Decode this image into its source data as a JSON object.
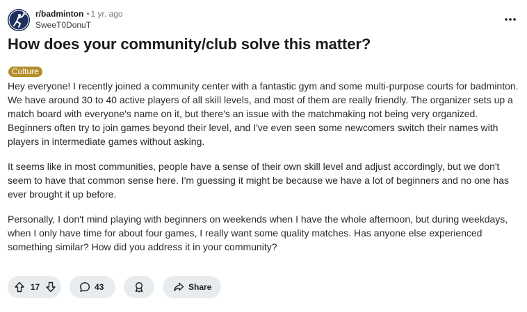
{
  "post": {
    "subreddit": "r/badminton",
    "separator": "•",
    "age": "1 yr. ago",
    "author": "SweeT0DonuT",
    "title": "How does your community/club solve this matter?",
    "flair": "Culture",
    "paragraphs": [
      "Hey everyone! I recently joined a community center with a fantastic gym and some multi-purpose courts for badminton. We have around 30 to 40 active players of all skill levels, and most of them are really friendly. The organizer sets up a match board with everyone's name on it, but there's an issue with the matchmaking not being very organized. Beginners often try to join games beyond their level, and I've even seen some newcomers switch their names with players in intermediate games without asking.",
      "It seems like in most communities, people have a sense of their own skill level and adjust accordingly, but we don't seem to have that common sense here. I'm guessing it might be because we have a lot of beginners and no one has ever brought it up before.",
      "Personally, I don't mind playing with beginners on weekends when I have the whole afternoon, but during weekdays, when I only have time for about four games, I really want some quality matches. Has anyone else experienced something similar? How did you address it in your community?"
    ]
  },
  "actions": {
    "vote_count": "17",
    "comment_count": "43",
    "share_label": "Share"
  },
  "icons": {
    "more": "ellipsis-icon",
    "upvote": "upvote-icon",
    "downvote": "downvote-icon",
    "comment": "comment-icon",
    "award": "award-icon",
    "share": "share-icon"
  },
  "colors": {
    "flair_bg": "#b68d2c",
    "pill_bg": "#e9ecee",
    "avatar_bg": "#1d2f5c"
  }
}
